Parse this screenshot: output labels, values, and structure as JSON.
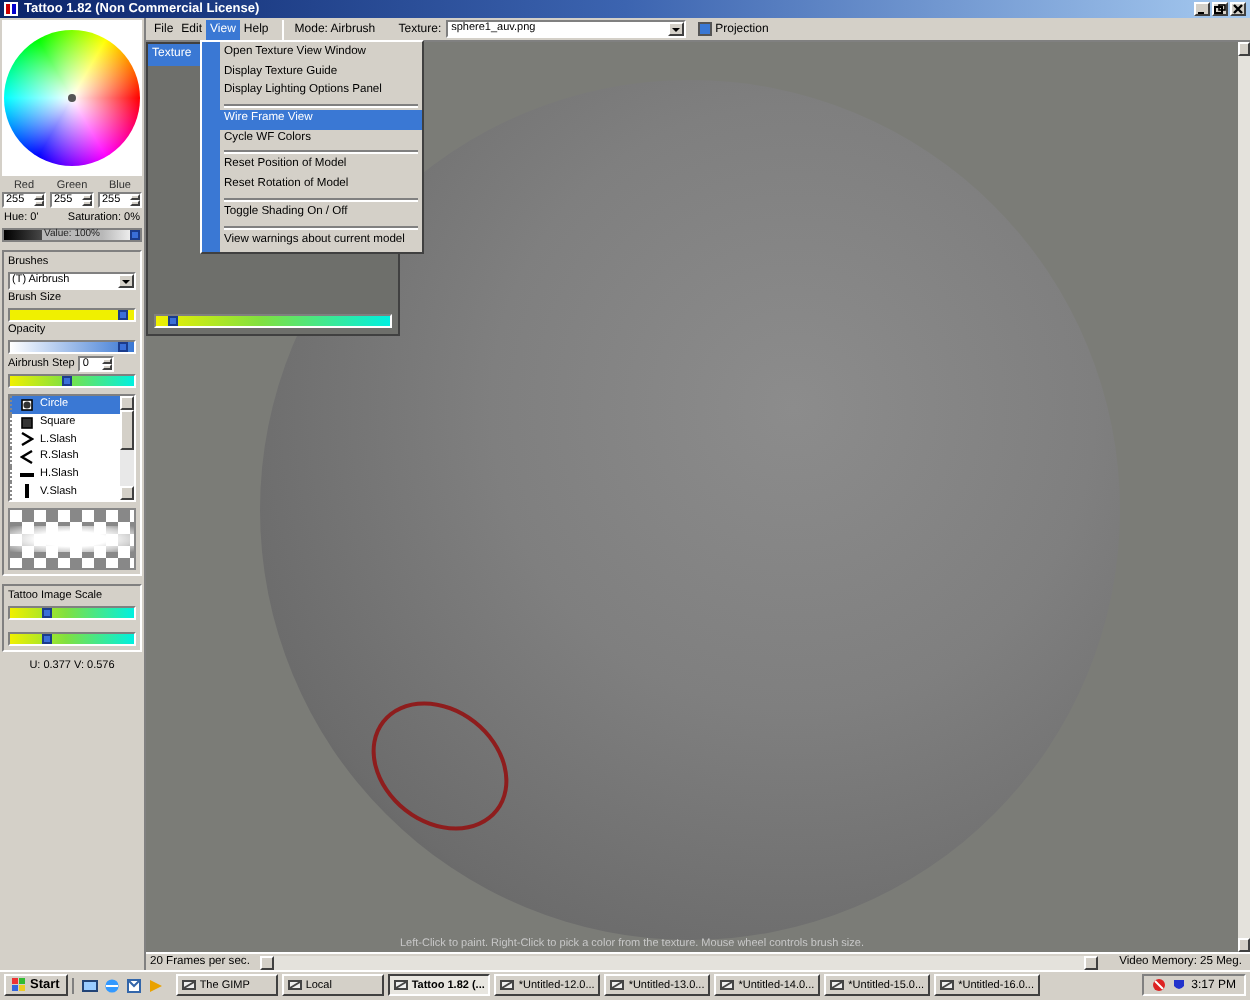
{
  "window": {
    "title": "Tattoo 1.82 (Non Commercial License)"
  },
  "color_picker": {
    "channels": [
      {
        "label": "Red",
        "value": "255"
      },
      {
        "label": "Green",
        "value": "255"
      },
      {
        "label": "Blue",
        "value": "255"
      }
    ],
    "hue": "Hue: 0'",
    "saturation": "Saturation: 0%",
    "value_slider": {
      "label": "Value: 100%",
      "level": 1
    }
  },
  "brushes": {
    "title": "Brushes",
    "type": "(T) Airbrush",
    "brush_size": {
      "label": "Brush Size",
      "level": 0.95
    },
    "opacity": {
      "label": "Opacity",
      "level": 0.95
    },
    "airbrush_step": {
      "label": "Airbrush Step",
      "value": "0",
      "level": 0.45
    },
    "shapes": [
      {
        "kind": "circle",
        "label": "Circle",
        "selected": true
      },
      {
        "kind": "square",
        "label": "Square",
        "selected": false
      },
      {
        "kind": "lslash",
        "label": "L.Slash",
        "selected": false
      },
      {
        "kind": "rslash",
        "label": "R.Slash",
        "selected": false
      },
      {
        "kind": "hslash",
        "label": "H.Slash",
        "selected": false
      },
      {
        "kind": "vslash",
        "label": "V.Slash",
        "selected": false
      }
    ]
  },
  "image_scale": {
    "title": "Tattoo Image Scale",
    "sliders": [
      {
        "level": 0.28
      },
      {
        "level": 0.28
      }
    ]
  },
  "uv": "U: 0.377  V: 0.576",
  "menubar": {
    "items": [
      {
        "label": "File",
        "selected": false
      },
      {
        "label": "Edit",
        "selected": false
      },
      {
        "label": "View",
        "selected": true
      },
      {
        "label": "Help",
        "selected": false
      }
    ],
    "mode": "Mode: Airbrush",
    "texture_label": "Texture:",
    "texture_value": "sphere1_auv.png",
    "projection": {
      "label": "Projection",
      "checked": true
    }
  },
  "view_menu": {
    "items": [
      {
        "kind": "item",
        "label": "Open Texture View Window",
        "selected": false
      },
      {
        "kind": "item",
        "label": "Display Texture Guide",
        "selected": false
      },
      {
        "kind": "item",
        "label": "Display Lighting Options Panel",
        "selected": false
      },
      {
        "kind": "separator"
      },
      {
        "kind": "item",
        "label": "Wire Frame View",
        "selected": true
      },
      {
        "kind": "item",
        "label": "Cycle WF Colors",
        "selected": false
      },
      {
        "kind": "separator"
      },
      {
        "kind": "item",
        "label": "Reset Position of Model",
        "selected": false
      },
      {
        "kind": "item",
        "label": "Reset Rotation of Model",
        "selected": false
      },
      {
        "kind": "separator"
      },
      {
        "kind": "item",
        "label": "Toggle Shading On / Off",
        "selected": false
      },
      {
        "kind": "separator"
      },
      {
        "kind": "item",
        "label": "View warnings about current model",
        "selected": false
      }
    ]
  },
  "texture_view": {
    "title": "Texture",
    "slider": {
      "level": 0.05
    }
  },
  "viewport": {
    "hint": "Left-Click to paint. Right-Click to pick a color from the texture. Mouse wheel controls brush size."
  },
  "status_bar": {
    "fps": "20 Frames per sec.",
    "video_memory": "Video Memory: 25 Meg."
  },
  "taskbar": {
    "start": "Start",
    "tasks": [
      {
        "label": "The GIMP",
        "selected": false
      },
      {
        "label": "Local",
        "selected": false
      },
      {
        "label": "Tattoo 1.82 (...",
        "selected": true
      },
      {
        "label": "*Untitled-12.0...",
        "selected": false
      },
      {
        "label": "*Untitled-13.0...",
        "selected": false
      },
      {
        "label": "*Untitled-14.0...",
        "selected": false
      },
      {
        "label": "*Untitled-15.0...",
        "selected": false
      },
      {
        "label": "*Untitled-16.0...",
        "selected": false
      }
    ],
    "clock": "3:17 PM"
  }
}
